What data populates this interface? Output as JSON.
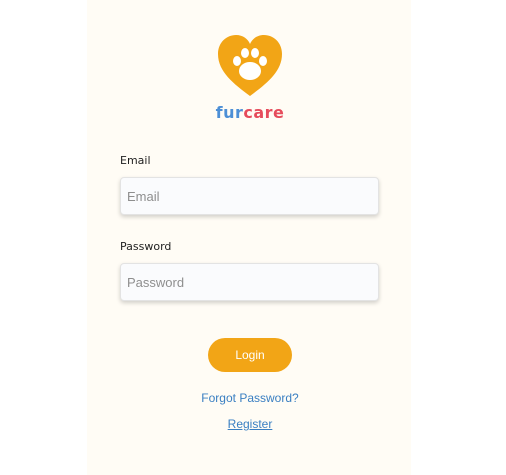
{
  "brand": {
    "logo_icon": "paw-heart-icon",
    "name_part1": "fur",
    "name_part2": "care",
    "colors": {
      "heart": "#f2a516",
      "fur": "#4d8fd6",
      "care": "#e64b5b"
    }
  },
  "form": {
    "email_label": "Email",
    "email_placeholder": "Email",
    "email_value": "",
    "password_label": "Password",
    "password_placeholder": "Password",
    "password_value": "",
    "login_label": "Login"
  },
  "links": {
    "forgot_password": "Forgot Password?",
    "register": "Register"
  },
  "theme": {
    "accent": "#f2a516",
    "link": "#3a7fc2",
    "panel_bg": "#fffcf5"
  }
}
